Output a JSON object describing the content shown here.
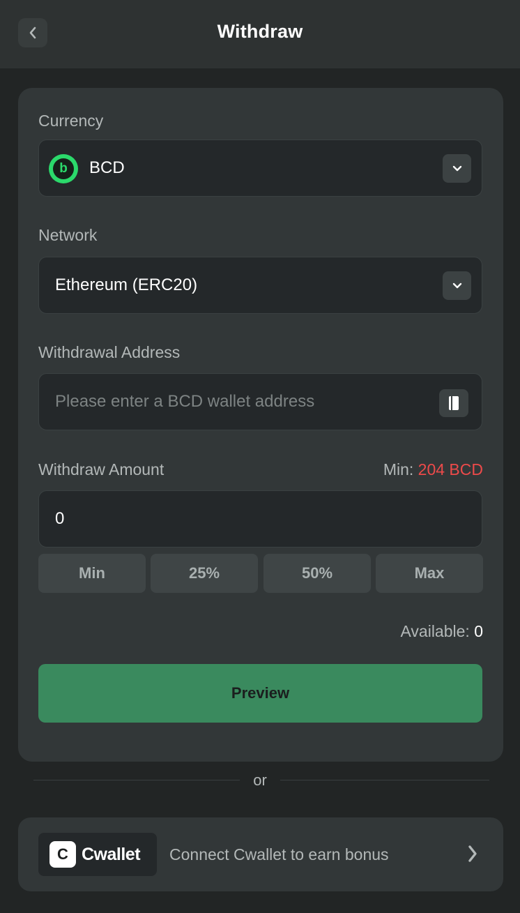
{
  "header": {
    "title": "Withdraw"
  },
  "form": {
    "currency_label": "Currency",
    "currency_value": "BCD",
    "currency_icon_letter": "b",
    "network_label": "Network",
    "network_value": "Ethereum (ERC20)",
    "address_label": "Withdrawal Address",
    "address_placeholder": "Please enter a BCD wallet address",
    "amount_label": "Withdraw Amount",
    "min_prefix": "Min:",
    "min_value": "204 BCD",
    "amount_value": "0",
    "quick_buttons": [
      "Min",
      "25%",
      "50%",
      "Max"
    ],
    "available_label": "Available:",
    "available_value": "0",
    "preview_label": "Preview"
  },
  "divider": {
    "or_text": "or"
  },
  "cwallet": {
    "badge_letter": "C",
    "logo_name": "Cwallet",
    "text": "Connect Cwallet to earn bonus"
  },
  "colors": {
    "background": "#222525",
    "card": "#323738",
    "accent_green": "#3a8a5e",
    "coin_green": "#2bd96b",
    "min_red": "#ed4a4a"
  },
  "icons": {
    "back": "chevron-left-icon",
    "dropdown": "chevron-down-icon",
    "address_book": "book-icon",
    "arrow": "chevron-right-icon"
  }
}
